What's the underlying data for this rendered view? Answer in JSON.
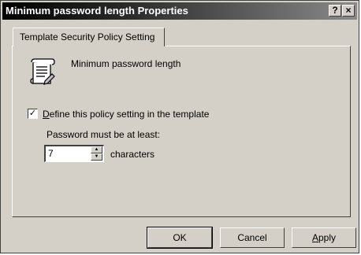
{
  "window": {
    "title": "Minimum password length Properties",
    "help_label": "?",
    "close_label": "×"
  },
  "tab": {
    "label": "Template Security Policy Setting"
  },
  "policy": {
    "icon": "policy-scroll-icon",
    "name": "Minimum password length"
  },
  "define_setting": {
    "checked": true,
    "check_glyph": "✓",
    "label": "Define this policy setting in the template"
  },
  "password_length": {
    "label": "Password must be at least:",
    "value": "7",
    "units": "characters",
    "spin_up": "▲",
    "spin_down": "▼"
  },
  "buttons": {
    "ok": "OK",
    "cancel": "Cancel",
    "apply": "Apply"
  }
}
